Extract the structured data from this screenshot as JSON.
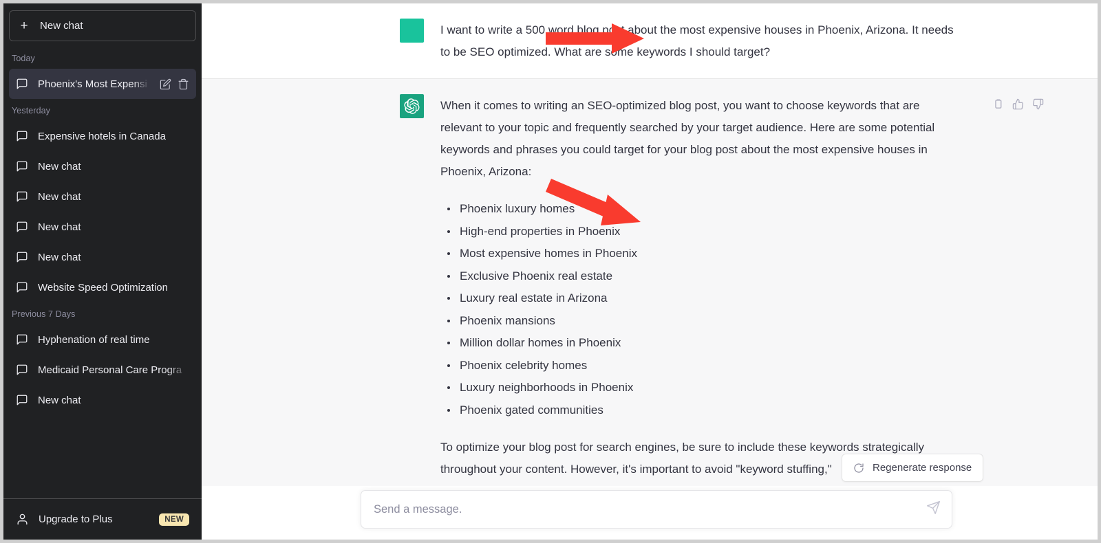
{
  "sidebar": {
    "new_chat_label": "New chat",
    "new_chat_icon": "plus-icon",
    "groups": [
      {
        "label": "Today",
        "items": [
          {
            "title": "Phoenix's Most Expensi",
            "icon": "chat-bubble-icon",
            "active": true,
            "actions": [
              "edit-icon",
              "trash-icon"
            ]
          }
        ]
      },
      {
        "label": "Yesterday",
        "items": [
          {
            "title": "Expensive hotels in Canada",
            "icon": "chat-bubble-icon",
            "active": false
          },
          {
            "title": "New chat",
            "icon": "chat-bubble-icon",
            "active": false
          },
          {
            "title": "New chat",
            "icon": "chat-bubble-icon",
            "active": false
          },
          {
            "title": "New chat",
            "icon": "chat-bubble-icon",
            "active": false
          },
          {
            "title": "New chat",
            "icon": "chat-bubble-icon",
            "active": false
          },
          {
            "title": "Website Speed Optimization",
            "icon": "chat-bubble-icon",
            "active": false
          }
        ]
      },
      {
        "label": "Previous 7 Days",
        "items": [
          {
            "title": "Hyphenation of real time",
            "icon": "chat-bubble-icon",
            "active": false
          },
          {
            "title": "Medicaid Personal Care Progra",
            "icon": "chat-bubble-icon",
            "active": false
          },
          {
            "title": "New chat",
            "icon": "chat-bubble-icon",
            "active": false
          }
        ]
      }
    ],
    "footer": {
      "upgrade_label": "Upgrade to Plus",
      "upgrade_icon": "person-icon",
      "badge": "NEW",
      "badge_color": "#f8e6b0"
    },
    "background_color": "#202123",
    "active_item_color": "#343541"
  },
  "conversation": {
    "user_message": {
      "avatar_color": "#19c39c",
      "text": "I want to write a 500 word blog post about the most expensive houses in Phoenix, Arizona. It needs to be SEO optimized. What are some keywords I should target?"
    },
    "assistant_message": {
      "avatar_color": "#19a37f",
      "avatar_icon": "openai-logo-icon",
      "paragraph_1": "When it comes to writing an SEO-optimized blog post, you want to choose keywords that are relevant to your topic and frequently searched by your target audience. Here are some potential keywords and phrases you could target for your blog post about the most expensive houses in Phoenix, Arizona:",
      "keywords": [
        "Phoenix luxury homes",
        "High-end properties in Phoenix",
        "Most expensive homes in Phoenix",
        "Exclusive Phoenix real estate",
        "Luxury real estate in Arizona",
        "Phoenix mansions",
        "Million dollar homes in Phoenix",
        "Phoenix celebrity homes",
        "Luxury neighborhoods in Phoenix",
        "Phoenix gated communities"
      ],
      "paragraph_2": "To optimize your blog post for search engines, be sure to include these keywords strategically throughout your content. However, it's important to avoid \"keyword stuffing,\"",
      "actions": [
        "copy-icon",
        "thumbs-up-icon",
        "thumbs-down-icon"
      ]
    }
  },
  "regenerate": {
    "label": "Regenerate response",
    "icon": "refresh-icon"
  },
  "composer": {
    "placeholder": "Send a message.",
    "value": "",
    "send_icon": "paper-plane-icon"
  },
  "annotations": {
    "arrow_color": "#f93b2e",
    "arrow_user_message": "horizontal-right-arrow",
    "arrow_keyword_list": "diagonal-down-right-arrow"
  }
}
